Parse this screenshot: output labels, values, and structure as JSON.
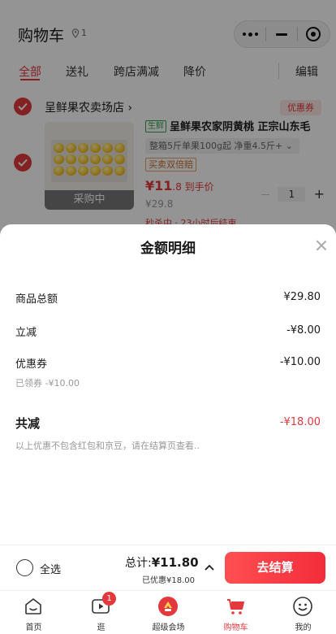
{
  "header": {
    "title": "购物车",
    "location_count": "1",
    "capsule": {
      "more_icon": "more-dots-icon",
      "minimize_icon": "minimize-icon",
      "close_icon": "target-circle-icon"
    }
  },
  "tabs": [
    {
      "label": "全部",
      "active": true
    },
    {
      "label": "送礼"
    },
    {
      "label": "跨店满减"
    },
    {
      "label": "降价"
    }
  ],
  "edit_label": "编辑",
  "shop": {
    "name": "呈鲜果农卖场店 ›",
    "coupon_label": "优惠券"
  },
  "product": {
    "fresh_tag": "生鲜",
    "title": "呈鲜果农家阴黄桃 正宗山东毛",
    "spec": "整箱5斤单果100g起 净重4.5斤+ ⌄",
    "double_tag": "买卖双倍赔",
    "price_now_big": "¥11",
    "price_now_small": ".8 到手价",
    "price_old": "¥29.8",
    "quantity": "1",
    "state": "采购中",
    "promo": "秒杀中 · 23小时后结束"
  },
  "sheet": {
    "title": "金额明细",
    "rows": [
      {
        "label": "商品总额",
        "value": "¥29.80"
      },
      {
        "label": "立减",
        "value": "-¥8.00"
      },
      {
        "label": "优惠券",
        "value": "-¥10.00",
        "sub": "已领券 -¥10.00"
      }
    ],
    "total_label": "共减",
    "total_value": "-¥18.00",
    "note": "以上优惠不包含红包和京豆，请在结算页查看.."
  },
  "checkout": {
    "select_all": "全选",
    "total_prefix": "总计:",
    "total_value": "¥11.80",
    "saved": "已优惠¥18.00",
    "pay_label": "去结算"
  },
  "tabbar": [
    {
      "label": "首页",
      "icon": "home-icon"
    },
    {
      "label": "逛",
      "icon": "video-play-icon",
      "badge": "1"
    },
    {
      "label": "超级会场",
      "icon": "super-venue-icon"
    },
    {
      "label": "购物车",
      "icon": "cart-icon",
      "active": true
    },
    {
      "label": "我的",
      "icon": "profile-face-icon"
    }
  ],
  "colors": {
    "accent": "#e4393c",
    "fresh_green": "#2da44e",
    "overlay": "rgba(0,0,0,0.42)"
  }
}
